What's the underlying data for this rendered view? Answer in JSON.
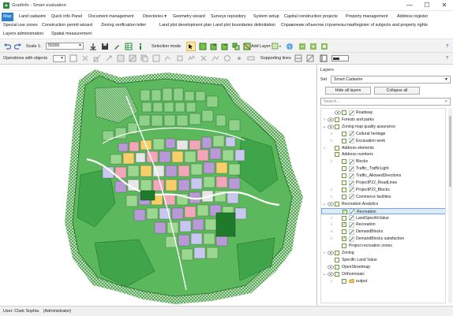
{
  "window": {
    "title": "GradInfo - Smart evaluation",
    "minimize": "—",
    "maximize": "☐",
    "close": "✕"
  },
  "menu": {
    "row1": [
      "Map",
      "Land cadastre",
      "Quick info Panel",
      "Document management",
      "Directories ▾",
      "Geometry wizard",
      "Surveys repository",
      "System setup",
      "Capital construction projects",
      "Property management",
      "Address register"
    ],
    "row2": [
      "Special use zones",
      "Construction permit wizard",
      "Zoning verification letter",
      "Land plot development plan",
      "Land plot boundaries delimitation",
      "Справочник объектов строительства",
      "Register of subjects and property rights"
    ],
    "row3": [
      "Layers administration",
      "Spatial measurement"
    ]
  },
  "toolbar": {
    "scale_label": "Scale 1:",
    "scale_value": "55000",
    "selection_mode_label": "Selection mode",
    "add_layer_label": "Add Layer:",
    "operations_label": "Operations with objects",
    "supporting_lines_label": "Supporting lines",
    "help": "?"
  },
  "panel": {
    "title": "Layers",
    "set_label": "Set",
    "set_value": "Smart Cadastre",
    "hide_all": "Hide all layers",
    "collapse_all": "Collapse all",
    "search_placeholder": "Search...",
    "tree": [
      {
        "indent": 2,
        "exp": "",
        "eye": true,
        "chk": false,
        "icon": "green",
        "label": "Roadway"
      },
      {
        "indent": 1,
        "exp": "›",
        "eye": true,
        "chk": false,
        "icon": "",
        "label": "Forests and parks"
      },
      {
        "indent": 1,
        "exp": "⌄",
        "eye": true,
        "chk": false,
        "icon": "",
        "label": "Zoning map quality assurance"
      },
      {
        "indent": 2,
        "exp": "›",
        "eye": false,
        "chk": false,
        "icon": "green",
        "label": "Cultural heritage"
      },
      {
        "indent": 2,
        "exp": "›",
        "eye": false,
        "chk": false,
        "icon": "green",
        "label": "Excavation work"
      },
      {
        "indent": 1,
        "exp": "›",
        "eye": false,
        "chk": false,
        "icon": "",
        "label": "Address elements"
      },
      {
        "indent": 1,
        "exp": "",
        "eye": false,
        "chk": false,
        "icon": "",
        "label": "Address numbers"
      },
      {
        "indent": 2,
        "exp": "›",
        "eye": false,
        "chk": false,
        "icon": "green",
        "label": "Blocks"
      },
      {
        "indent": 2,
        "exp": "",
        "eye": false,
        "chk": false,
        "icon": "green",
        "label": "Traffic_TrafficLight"
      },
      {
        "indent": 2,
        "exp": "",
        "eye": false,
        "chk": false,
        "icon": "green",
        "label": "Traffic_AllowedDirections"
      },
      {
        "indent": 2,
        "exp": "",
        "eye": false,
        "chk": false,
        "icon": "green",
        "label": "ProjectP22_RoadLines"
      },
      {
        "indent": 2,
        "exp": "›",
        "eye": false,
        "chk": false,
        "icon": "green",
        "label": "ProjectP22_Blocks"
      },
      {
        "indent": 2,
        "exp": "›",
        "eye": false,
        "chk": false,
        "icon": "green",
        "label": "Commerce facilities"
      },
      {
        "indent": 1,
        "exp": "⌄",
        "eye": true,
        "chk": false,
        "icon": "",
        "label": "Recreation Analytics"
      },
      {
        "indent": 2,
        "exp": "",
        "eye": false,
        "chk": true,
        "icon": "green",
        "label": "Recreation",
        "selected": true
      },
      {
        "indent": 2,
        "exp": "›",
        "eye": false,
        "chk": false,
        "icon": "green",
        "label": "LandSpecificValue"
      },
      {
        "indent": 2,
        "exp": "›",
        "eye": false,
        "chk": true,
        "icon": "green",
        "label": "Recreation"
      },
      {
        "indent": 2,
        "exp": "›",
        "eye": false,
        "chk": false,
        "icon": "green",
        "label": "DemandBlocks"
      },
      {
        "indent": 2,
        "exp": "›",
        "eye": false,
        "chk": true,
        "icon": "green",
        "label": "DemandBlocks satisfaction"
      },
      {
        "indent": 2,
        "exp": "",
        "eye": false,
        "chk": false,
        "icon": "",
        "label": "Project recreation zones"
      },
      {
        "indent": 1,
        "exp": "›",
        "eye": true,
        "chk": false,
        "icon": "",
        "label": "Zoning"
      },
      {
        "indent": 1,
        "exp": "",
        "eye": false,
        "chk": false,
        "icon": "",
        "label": "Specific Land Value"
      },
      {
        "indent": 1,
        "exp": "",
        "eye": true,
        "chk": false,
        "icon": "",
        "label": "OpenStreetmap"
      },
      {
        "indent": 1,
        "exp": "⌄",
        "eye": true,
        "chk": false,
        "icon": "",
        "label": "Orthomosaic"
      },
      {
        "indent": 2,
        "exp": "›",
        "eye": false,
        "chk": false,
        "icon": "folder",
        "label": "output"
      }
    ]
  },
  "status": {
    "user": "User: Clark Sophia",
    "role": "(Administrator)"
  }
}
